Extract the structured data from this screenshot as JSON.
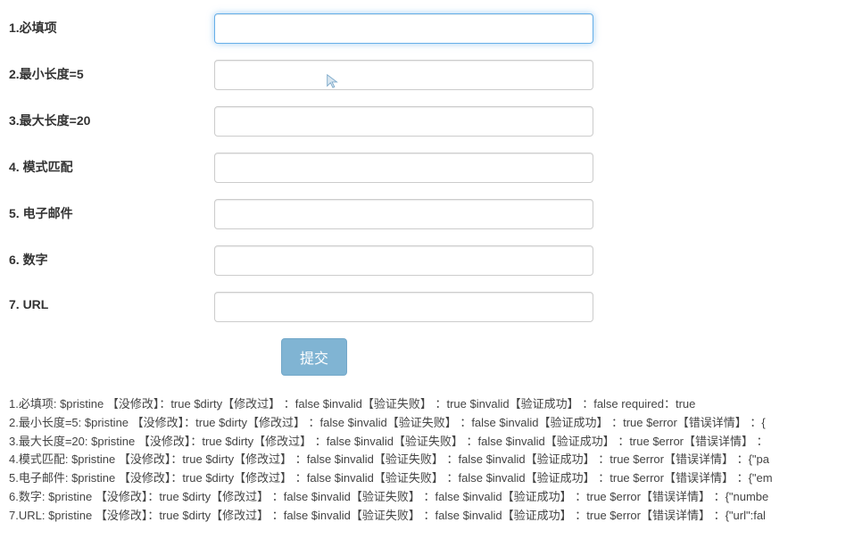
{
  "fields": [
    {
      "label": "1.必填项",
      "value": "",
      "placeholder": "",
      "focused": true
    },
    {
      "label": "2.最小长度=5",
      "value": "",
      "placeholder": "",
      "focused": false
    },
    {
      "label": "3.最大长度=20",
      "value": "",
      "placeholder": "",
      "focused": false
    },
    {
      "label": "4. 模式匹配",
      "value": "",
      "placeholder": "",
      "focused": false
    },
    {
      "label": "5. 电子邮件",
      "value": "",
      "placeholder": "",
      "focused": false
    },
    {
      "label": "6. 数字",
      "value": "",
      "placeholder": "",
      "focused": false
    },
    {
      "label": "7. URL",
      "value": "",
      "placeholder": "",
      "focused": false
    }
  ],
  "submit_label": "提交",
  "status_lines": [
    "1.必填项:    $pristine 【没修改】：true   $dirty【修改过】 ：false   $invalid【验证失败】 ：true   $invalid【验证成功】 ：false   required：true",
    "2.最小长度=5: $pristine 【没修改】：true   $dirty【修改过】 ：false   $invalid【验证失败】 ：false   $invalid【验证成功】 ：true   $error【错误详情】 ：{",
    "3.最大长度=20: $pristine 【没修改】：true   $dirty【修改过】 ：false   $invalid【验证失败】 ：false   $invalid【验证成功】 ：true   $error【错误详情】 ：",
    "4.模式匹配: $pristine 【没修改】：true   $dirty【修改过】 ：false   $invalid【验证失败】 ：false   $invalid【验证成功】 ：true   $error【错误详情】 ：{\"pa",
    "5.电子邮件: $pristine 【没修改】：true   $dirty【修改过】 ：false   $invalid【验证失败】 ：false   $invalid【验证成功】 ：true   $error【错误详情】 ：{\"em",
    "6.数字: $pristine 【没修改】：true   $dirty【修改过】 ：false   $invalid【验证失败】 ：false   $invalid【验证成功】 ：true   $error【错误详情】 ：{\"numbe",
    "7.URL: $pristine 【没修改】：true   $dirty【修改过】 ：false   $invalid【验证失败】 ：false   $invalid【验证成功】 ：true   $error【错误详情】 ：{\"url\":fal"
  ]
}
